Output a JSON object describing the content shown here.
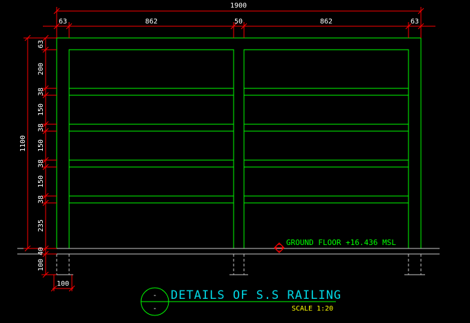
{
  "dimensions": {
    "overall_width": "1900",
    "post_left": "63",
    "span_left": "862",
    "post_mid": "50",
    "span_right": "862",
    "post_right": "63",
    "overall_height": "1100",
    "post_width": "100",
    "vertical": [
      "63",
      "200",
      "38",
      "150",
      "38",
      "150",
      "38",
      "150",
      "38",
      "235",
      "40",
      "100"
    ]
  },
  "level_label": "GROUND FLOOR +16.436 MSL",
  "title": {
    "text": "DETAILS OF S.S RAILING",
    "scale": "SCALE 1:20",
    "symbol_top": "-",
    "symbol_bottom": "-",
    "color": "#00d9e6"
  },
  "colors": {
    "structure": "#00ff00",
    "dimension_lines": "#ff0000",
    "dimension_text": "#ffffff",
    "ground_line": "#c8c8c8",
    "scale": "#ffff00"
  }
}
